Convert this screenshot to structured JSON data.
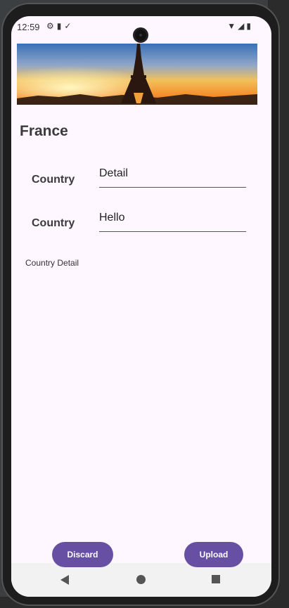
{
  "status_bar": {
    "time": "12:59",
    "left_icons": [
      "gear-icon",
      "sd-card-icon",
      "download-done-icon"
    ],
    "right_icons": [
      "wifi-icon",
      "signal-icon",
      "battery-icon"
    ]
  },
  "screen": {
    "title": "France",
    "rows": [
      {
        "label": "Country",
        "value": "Detail"
      },
      {
        "label": "Country",
        "value": "Hello"
      }
    ],
    "detail_text": "Country Detail",
    "buttons": {
      "discard": "Discard",
      "upload": "Upload"
    }
  },
  "colors": {
    "screen_bg": "#fef7ff",
    "button_bg": "#6750a4",
    "button_text": "#ffffff"
  }
}
